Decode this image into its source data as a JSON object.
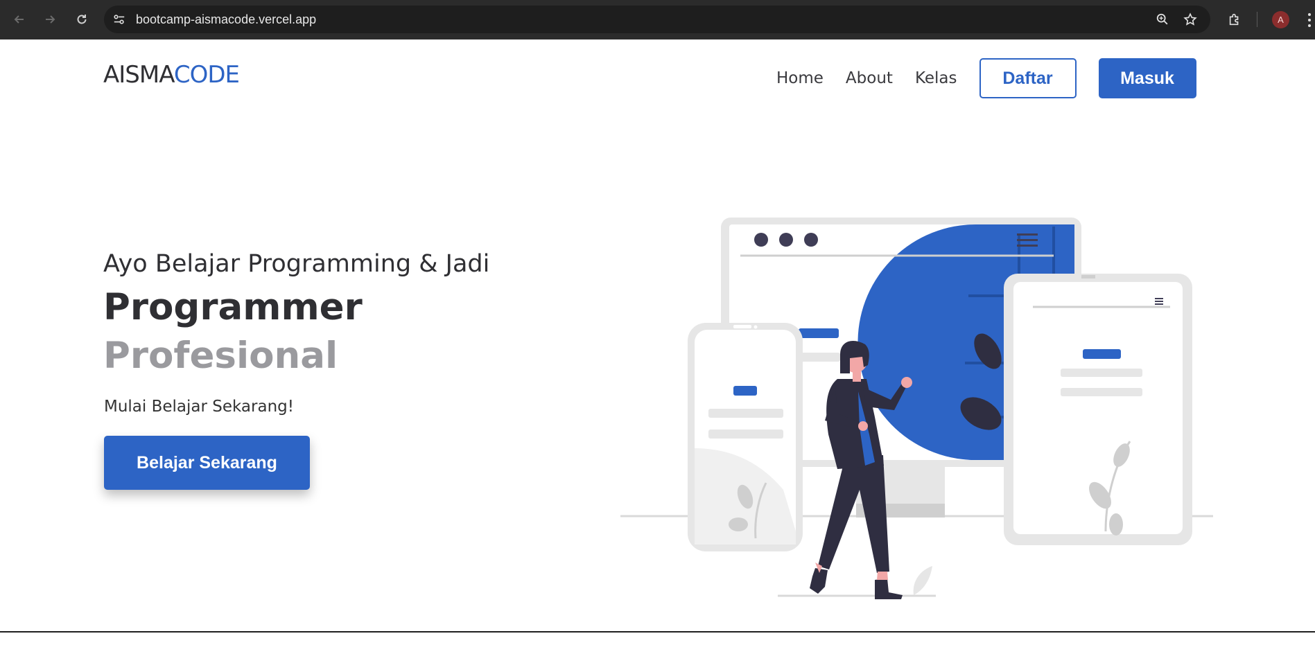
{
  "browser": {
    "url": "bootcamp-aismacode.vercel.app",
    "avatar_letter": "A",
    "icons": [
      "back-arrow-icon",
      "forward-arrow-icon",
      "reload-icon",
      "site-info-icon",
      "zoom-icon",
      "star-icon",
      "extensions-icon",
      "more-vert-icon"
    ]
  },
  "header": {
    "logo_part1": "AISMA",
    "logo_part2": "CODE",
    "nav": {
      "home": "Home",
      "about": "About",
      "kelas": "Kelas"
    },
    "daftar_label": "Daftar",
    "masuk_label": "Masuk"
  },
  "hero": {
    "line1": "Ayo Belajar Programming & Jadi",
    "line2": "Programmer",
    "line3": "Profesional",
    "subtitle": "Mulai Belajar Sekarang!",
    "cta_label": "Belajar Sekarang"
  },
  "colors": {
    "accent": "#2d64c5",
    "dark_text": "#2f2f33",
    "muted_text": "#9a9a9e"
  }
}
